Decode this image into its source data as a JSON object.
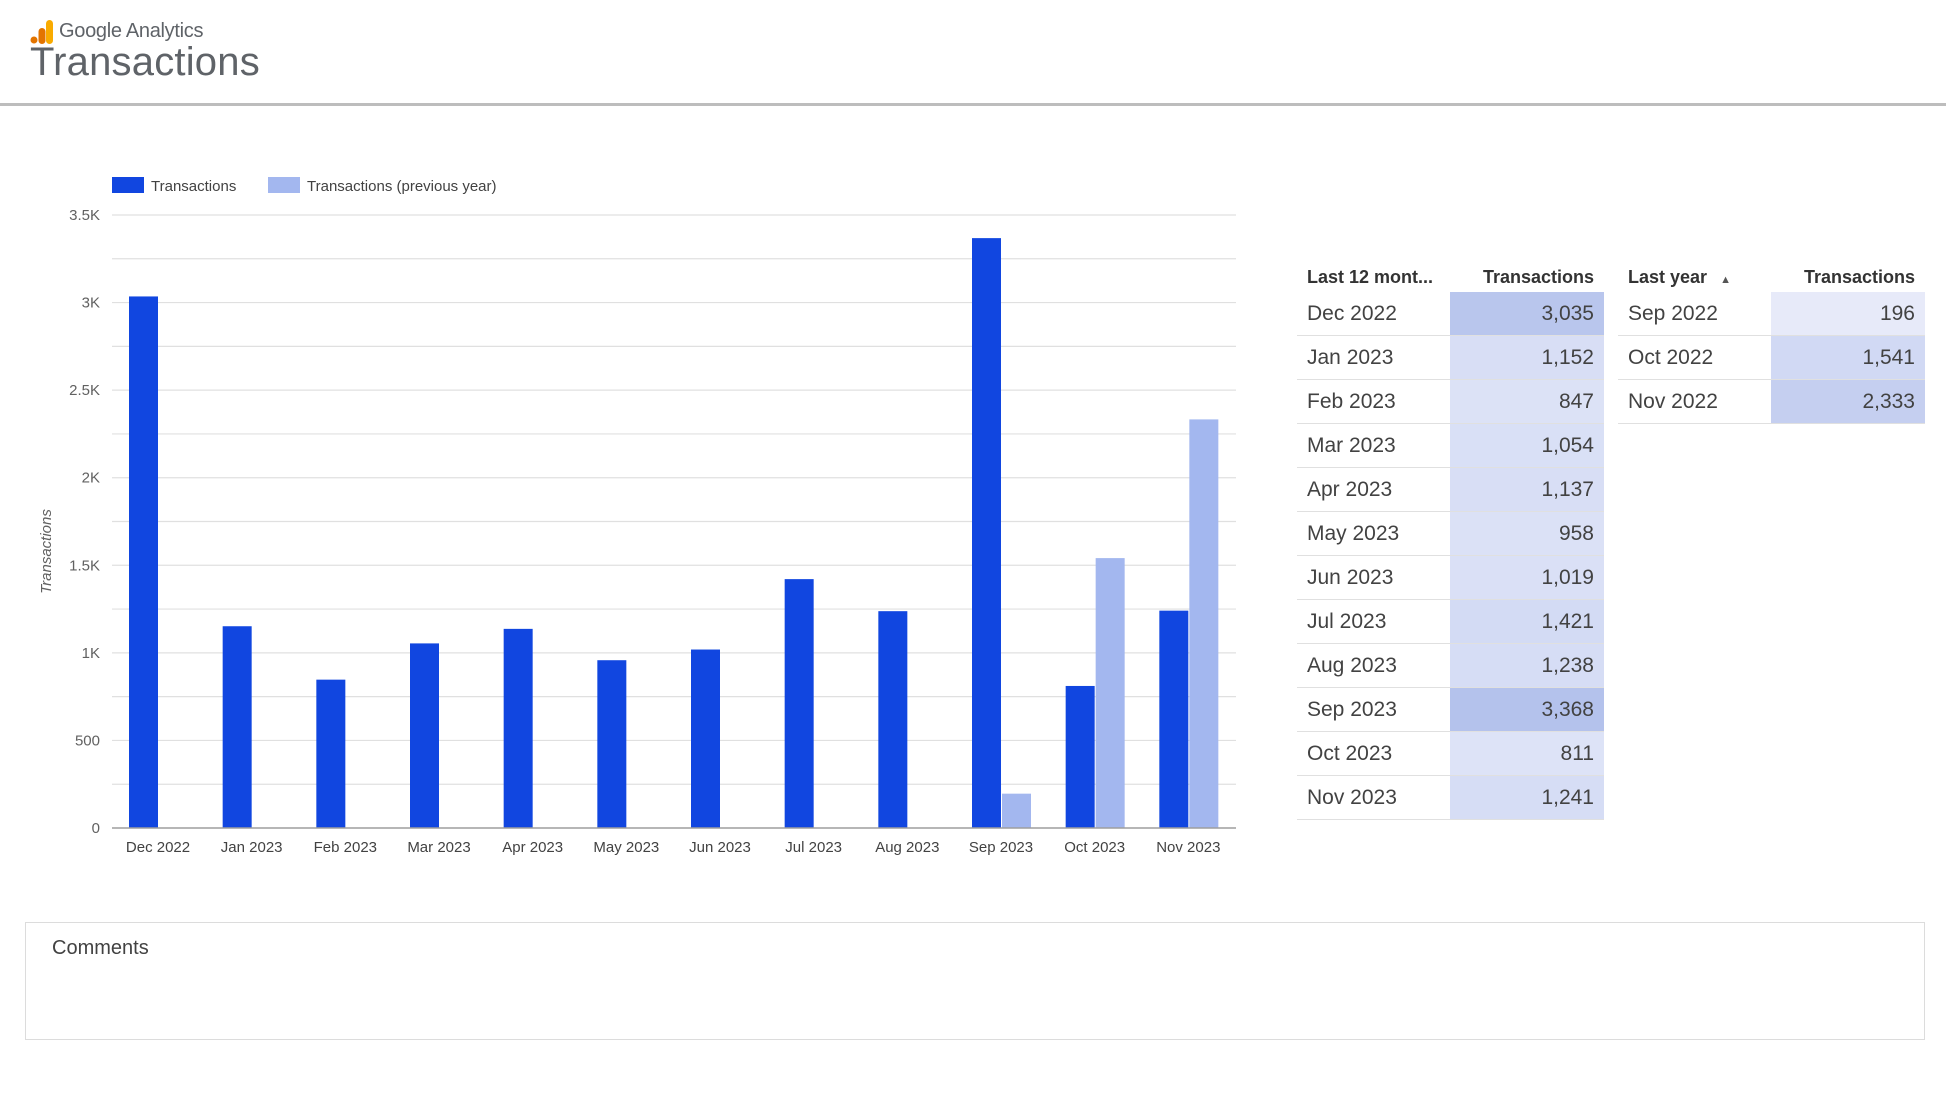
{
  "header": {
    "brand": "Google Analytics",
    "title": "Transactions"
  },
  "colors": {
    "current": "#1146e0",
    "previous": "#a3b7ef",
    "grid": "#e0e0e0",
    "axis": "#9e9e9e",
    "header_rule": "#bdbdbd",
    "logo_orange": "#f9ab00",
    "logo_yellow": "#e37400"
  },
  "chart_data": {
    "type": "bar",
    "categories": [
      "Dec 2022",
      "Jan 2023",
      "Feb 2023",
      "Mar 2023",
      "Apr 2023",
      "May 2023",
      "Jun 2023",
      "Jul 2023",
      "Aug 2023",
      "Sep 2023",
      "Oct 2023",
      "Nov 2023"
    ],
    "series": [
      {
        "name": "Transactions",
        "values": [
          3035,
          1152,
          847,
          1054,
          1137,
          958,
          1019,
          1421,
          1238,
          3368,
          811,
          1241
        ]
      },
      {
        "name": "Transactions (previous year)",
        "values": [
          null,
          null,
          null,
          null,
          null,
          null,
          null,
          null,
          null,
          196,
          1541,
          2333
        ]
      }
    ],
    "ylabel": "Transactions",
    "ylim": [
      0,
      3500
    ],
    "yticks": [
      0,
      500,
      1000,
      1500,
      2000,
      2500,
      3000,
      3500
    ],
    "ytick_labels": [
      "0",
      "500",
      "1K",
      "1.5K",
      "2K",
      "2.5K",
      "3K",
      "3.5K"
    ],
    "grid": true,
    "legend": "top-left"
  },
  "table_current": {
    "headers": [
      "Last 12 mont...",
      "Transactions"
    ],
    "max": 3368,
    "rows": [
      {
        "month": "Dec 2022",
        "value": 3035,
        "label": "3,035"
      },
      {
        "month": "Jan 2023",
        "value": 1152,
        "label": "1,152"
      },
      {
        "month": "Feb 2023",
        "value": 847,
        "label": "847"
      },
      {
        "month": "Mar 2023",
        "value": 1054,
        "label": "1,054"
      },
      {
        "month": "Apr 2023",
        "value": 1137,
        "label": "1,137"
      },
      {
        "month": "May 2023",
        "value": 958,
        "label": "958"
      },
      {
        "month": "Jun 2023",
        "value": 1019,
        "label": "1,019"
      },
      {
        "month": "Jul 2023",
        "value": 1421,
        "label": "1,421"
      },
      {
        "month": "Aug 2023",
        "value": 1238,
        "label": "1,238"
      },
      {
        "month": "Sep 2023",
        "value": 3368,
        "label": "3,368"
      },
      {
        "month": "Oct 2023",
        "value": 811,
        "label": "811"
      },
      {
        "month": "Nov 2023",
        "value": 1241,
        "label": "1,241"
      }
    ]
  },
  "table_previous": {
    "headers": [
      "Last year",
      "Transactions"
    ],
    "sort_indicator": "▲",
    "max": 3368,
    "rows": [
      {
        "month": "Sep 2022",
        "value": 196,
        "label": "196"
      },
      {
        "month": "Oct 2022",
        "value": 1541,
        "label": "1,541"
      },
      {
        "month": "Nov 2022",
        "value": 2333,
        "label": "2,333"
      }
    ]
  },
  "comments": {
    "label": "Comments"
  }
}
